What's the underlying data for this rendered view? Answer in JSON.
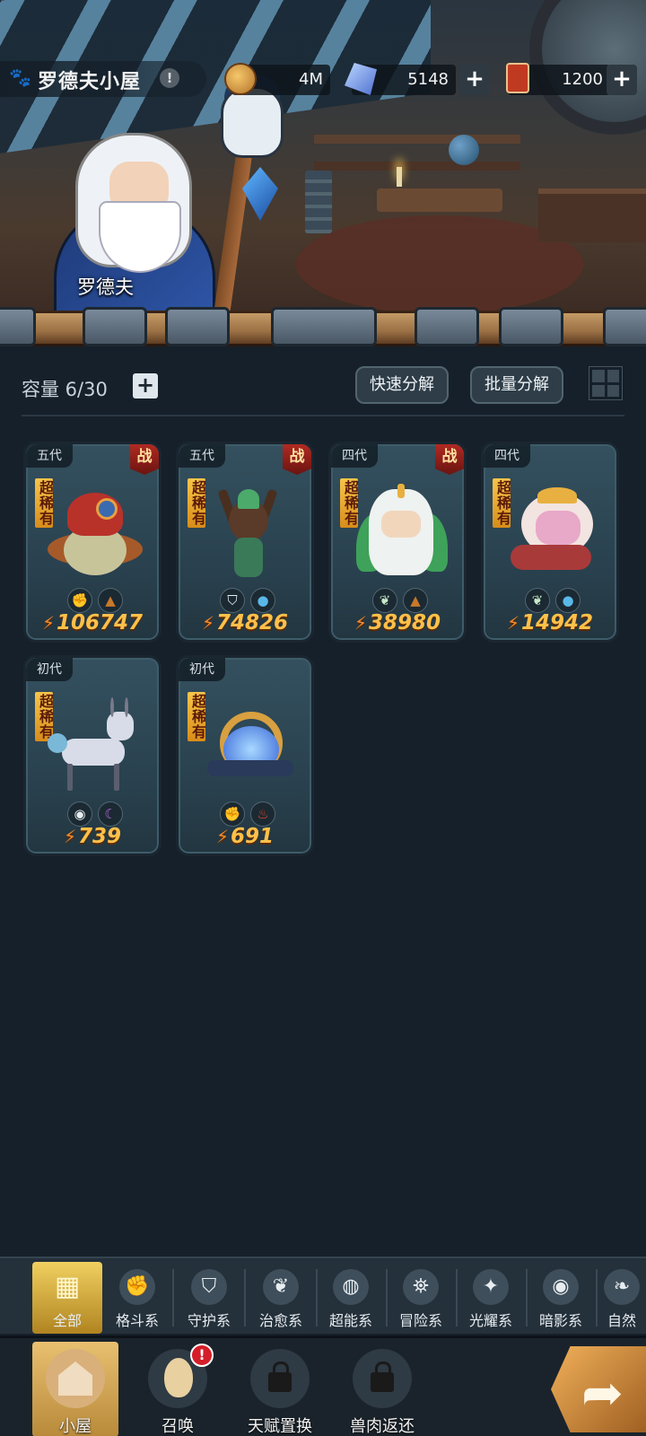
{
  "header": {
    "title": "罗德夫小屋",
    "info_icon": "!",
    "character_name": "罗德夫"
  },
  "resources": {
    "gold": "4M",
    "gems": "5148",
    "tickets": "1200",
    "plus": "+"
  },
  "storage": {
    "capacity_label": "容量 6/30",
    "add": "+",
    "quick_decompose": "快速分解",
    "batch_decompose": "批量分解"
  },
  "pets": [
    {
      "generation": "五代",
      "battle": "战",
      "rarity": "超稀有",
      "power": "106747",
      "types": [
        "fist-icon",
        "earth-icon"
      ]
    },
    {
      "generation": "五代",
      "battle": "战",
      "rarity": "超稀有",
      "power": "74826",
      "types": [
        "shield-icon",
        "water-icon"
      ]
    },
    {
      "generation": "四代",
      "battle": "战",
      "rarity": "超稀有",
      "power": "38980",
      "types": [
        "sprout-icon",
        "earth-icon"
      ]
    },
    {
      "generation": "四代",
      "battle": "",
      "rarity": "超稀有",
      "power": "14942",
      "types": [
        "sprout-icon",
        "water-icon"
      ]
    },
    {
      "generation": "初代",
      "battle": "",
      "rarity": "超稀有",
      "power": "739",
      "types": [
        "eye-icon",
        "moon-icon"
      ]
    },
    {
      "generation": "初代",
      "battle": "",
      "rarity": "超稀有",
      "power": "691",
      "types": [
        "fist-icon",
        "fire-icon"
      ]
    }
  ],
  "categories": [
    "全部",
    "格斗系",
    "守护系",
    "治愈系",
    "超能系",
    "冒险系",
    "光耀系",
    "暗影系",
    "自然"
  ],
  "nav": {
    "home": "小屋",
    "summon": "召唤",
    "talent": "天赋置换",
    "meat": "兽肉返还",
    "summon_badge": "!"
  }
}
